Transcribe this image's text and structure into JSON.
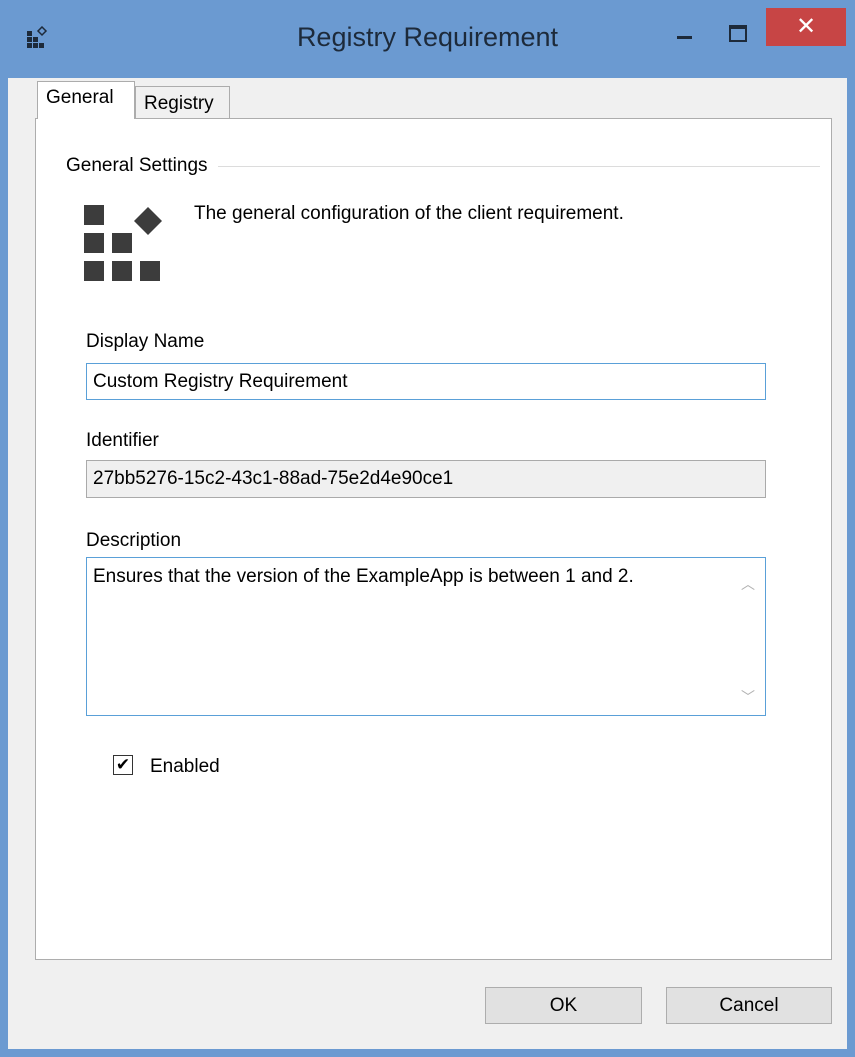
{
  "window": {
    "title": "Registry Requirement",
    "close_glyph": "✕"
  },
  "tabs": [
    {
      "label": "General"
    },
    {
      "label": "Registry"
    }
  ],
  "general": {
    "group_title": "General Settings",
    "description": "The general configuration of the client requirement.",
    "display_name": {
      "label": "Display Name",
      "value": "Custom Registry Requirement"
    },
    "identifier": {
      "label": "Identifier",
      "value": "27bb5276-15c2-43c1-88ad-75e2d4e90ce1"
    },
    "desc_field": {
      "label": "Description",
      "value": "Ensures that the version of the ExampleApp is between 1 and 2."
    },
    "enabled": {
      "label": "Enabled",
      "checked": true,
      "glyph": "✔"
    }
  },
  "buttons": {
    "ok": "OK",
    "cancel": "Cancel"
  },
  "colors": {
    "titlebar": "#6b9ad1",
    "close": "#c74545",
    "focus_border": "#5aa0d8"
  },
  "icons": [
    "app-icon",
    "requirement-icon",
    "scroll-up-icon",
    "scroll-down-icon"
  ]
}
